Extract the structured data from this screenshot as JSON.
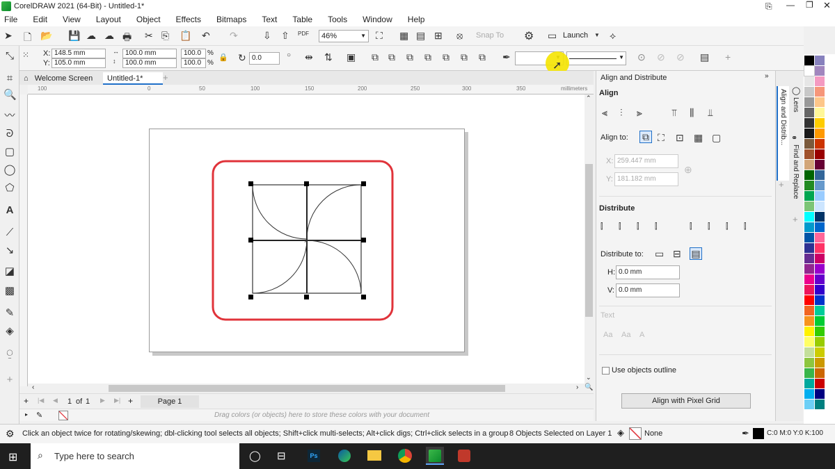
{
  "app": {
    "title": "CorelDRAW 2021 (64-Bit) - Untitled-1*"
  },
  "menu": [
    "File",
    "Edit",
    "View",
    "Layout",
    "Object",
    "Effects",
    "Bitmaps",
    "Text",
    "Table",
    "Tools",
    "Window",
    "Help"
  ],
  "toolbar": {
    "zoom_value": "46%",
    "snap_to": "Snap To",
    "launch": "Launch",
    "pdf_label": "PDF"
  },
  "propbar": {
    "x_label": "X:",
    "x_value": "148.5 mm",
    "y_label": "Y:",
    "y_value": "105.0 mm",
    "w_value": "100.0 mm",
    "h_value": "100.0 mm",
    "sx_value": "100.0",
    "sy_value": "100.0",
    "pct": "%",
    "rotation": "0.0"
  },
  "tabs": {
    "welcome": "Welcome Screen",
    "doc": "Untitled-1*",
    "add": "+"
  },
  "ruler": {
    "ticks": [
      "100",
      "0",
      "50",
      "100",
      "150",
      "200",
      "250",
      "300",
      "350"
    ],
    "unit": "millimeters"
  },
  "pagenav": {
    "current": "1",
    "of": "of",
    "total": "1",
    "page_tab": "Page 1"
  },
  "colorbar": {
    "hint": "Drag colors (or objects) here to store these colors with your document"
  },
  "docker": {
    "title": "Align and Distribute",
    "align_header": "Align",
    "align_to": "Align to:",
    "x_label": "X:",
    "x_value": "259.447 mm",
    "y_label": "Y:",
    "y_value": "181.182 mm",
    "distribute_header": "Distribute",
    "distribute_to": "Distribute to:",
    "h_label": "H:",
    "h_value": "0.0 mm",
    "v_label": "V:",
    "v_value": "0.0 mm",
    "text_header": "Text",
    "use_outline": "Use objects outline",
    "pixel_grid_button": "Align with Pixel Grid",
    "side_tabs": [
      "Lens",
      "Align and Distrib...",
      "Find and Replace"
    ]
  },
  "status": {
    "hint": "Click an object twice for rotating/skewing; dbl-clicking tool selects all objects; Shift+click multi-selects; Alt+click digs; Ctrl+click selects in a group",
    "selection": "8 Objects Selected on Layer 1",
    "fill": "None",
    "outline": "C:0 M:0 Y:0 K:100"
  },
  "taskbar": {
    "search_placeholder": "Type here to search"
  },
  "colors": {
    "accent": "#1e6fc8",
    "highlight_box": "#e0333a",
    "cursor_highlight": "#f5e400",
    "palette": [
      "#000000",
      "#ffffff",
      "#e6e6e6",
      "#c8c8c8",
      "#999999",
      "#666666",
      "#333333",
      "#1a1a1a",
      "#7b5a3c",
      "#a0522d",
      "#d2a679",
      "#006400",
      "#228b22",
      "#00a651",
      "#7cc576",
      "#00ffff",
      "#0099cc",
      "#0054a6",
      "#2e3192",
      "#662d91",
      "#92278f",
      "#ec008c",
      "#ed145b",
      "#ff0000",
      "#f26522",
      "#f7941d",
      "#fff200",
      "#ffff66",
      "#c4df9b",
      "#8dc63f",
      "#39b54a",
      "#00a99d",
      "#00aeef",
      "#6dcff6",
      "#8781bd",
      "#a186be",
      "#f49ac1",
      "#f69679",
      "#fdc689",
      "#fff799",
      "#ffcc00",
      "#ff9900",
      "#cc3300",
      "#990000",
      "#660033",
      "#336699",
      "#6699cc",
      "#99ccff",
      "#cce5ff",
      "#003366",
      "#0066cc",
      "#ff6699",
      "#ff3366",
      "#cc0066",
      "#9900cc",
      "#6600cc",
      "#3300cc",
      "#0033cc",
      "#00cc99",
      "#00cc33",
      "#33cc00",
      "#99cc00",
      "#cccc00",
      "#cc9900",
      "#cc6600",
      "#cc0000",
      "#000080",
      "#008080"
    ]
  }
}
